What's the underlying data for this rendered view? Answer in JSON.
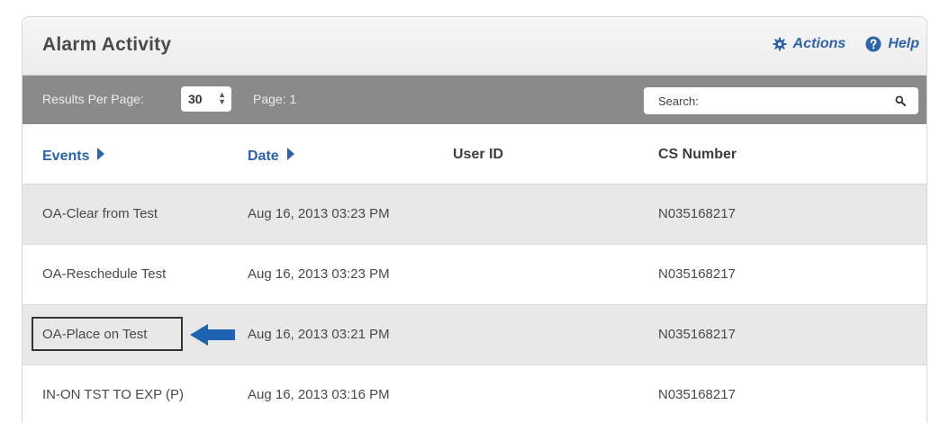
{
  "panel": {
    "title": "Alarm Activity",
    "actions_label": "Actions",
    "help_label": "Help",
    "actions_icon": "gear-icon",
    "help_icon": "question-circle-icon"
  },
  "toolbar": {
    "results_per_page_label": "Results Per Page:",
    "results_per_page_value": "30",
    "page_label": "Page: 1",
    "search_placeholder": "Search:",
    "search_icon": "search-icon"
  },
  "columns": {
    "events": "Events",
    "date": "Date",
    "user_id": "User ID",
    "cs_number": "CS Number"
  },
  "rows": [
    {
      "event": "OA-Clear from Test",
      "date": "Aug 16, 2013 03:23 PM",
      "user_id": "",
      "cs_number": "N035168217"
    },
    {
      "event": "OA-Reschedule Test",
      "date": "Aug 16, 2013 03:23 PM",
      "user_id": "",
      "cs_number": "N035168217"
    },
    {
      "event": "OA-Place on Test",
      "date": "Aug 16, 2013 03:21 PM",
      "user_id": "",
      "cs_number": "N035168217"
    },
    {
      "event": "IN-ON TST TO EXP (P)",
      "date": "Aug 16, 2013 03:16 PM",
      "user_id": "",
      "cs_number": "N035168217"
    }
  ],
  "colors": {
    "accent": "#2f63a8",
    "toolbar_bg": "#8a8a8a",
    "alt_row_bg": "#e8e8e8",
    "annotation_arrow": "#1e64b0"
  }
}
